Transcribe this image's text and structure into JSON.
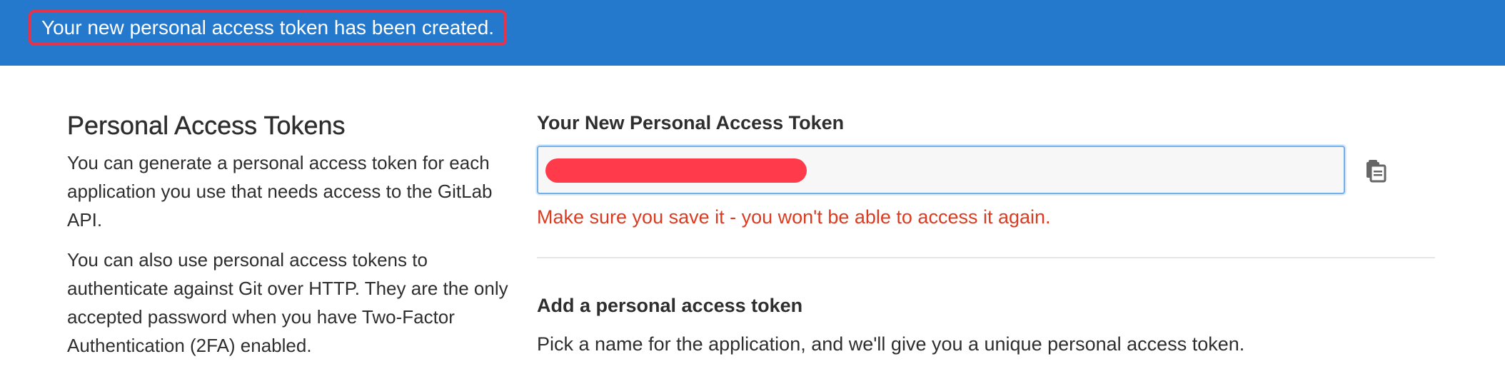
{
  "flash": {
    "message": "Your new personal access token has been created."
  },
  "sidebar": {
    "title": "Personal Access Tokens",
    "paragraph1": "You can generate a personal access token for each application you use that needs access to the GitLab API.",
    "paragraph2": "You can also use personal access tokens to authenticate against Git over HTTP. They are the only accepted password when you have Two-Factor Authentication (2FA) enabled."
  },
  "new_token": {
    "label": "Your New Personal Access Token",
    "value": "",
    "warning": "Make sure you save it - you won't be able to access it again.",
    "copy_icon": "clipboard-copy-icon"
  },
  "add_token": {
    "title": "Add a personal access token",
    "description": "Pick a name for the application, and we'll give you a unique personal access token."
  },
  "colors": {
    "banner": "#2479cc",
    "highlight": "#e5334b",
    "redaction": "#ff3a4b",
    "warning": "#db3b21"
  }
}
